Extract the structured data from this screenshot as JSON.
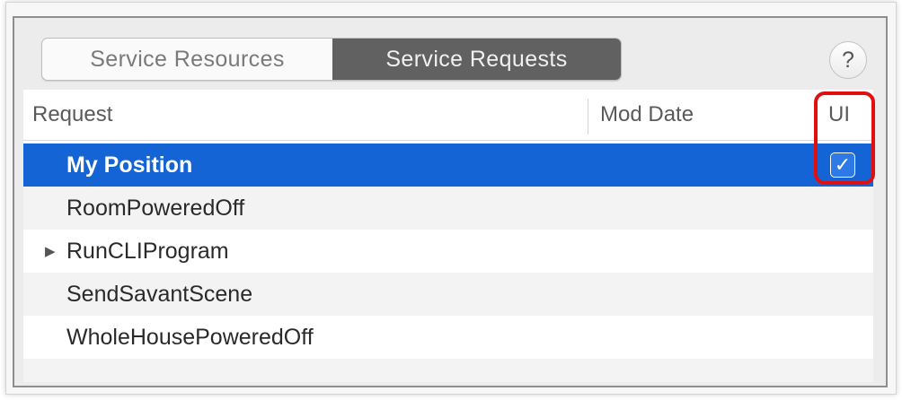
{
  "tabs": {
    "resources_label": "Service Resources",
    "requests_label": "Service Requests",
    "active": "Service Requests"
  },
  "help_label": "?",
  "table": {
    "columns": {
      "request": "Request",
      "mod_date": "Mod Date",
      "ui": "UI"
    },
    "rows": [
      {
        "name": "My Position",
        "selected": true,
        "ui_checked": true
      },
      {
        "name": "RoomPoweredOff",
        "selected": false
      },
      {
        "name": "RunCLIProgram",
        "selected": false,
        "expandable": true
      },
      {
        "name": "SendSavantScene",
        "selected": false
      },
      {
        "name": "WholeHousePoweredOff",
        "selected": false
      }
    ]
  },
  "checkmark": "✓",
  "disclosure_glyph": "▶",
  "colors": {
    "selection": "#1464d6",
    "annotation": "#e01010",
    "active_tab": "#616161"
  }
}
